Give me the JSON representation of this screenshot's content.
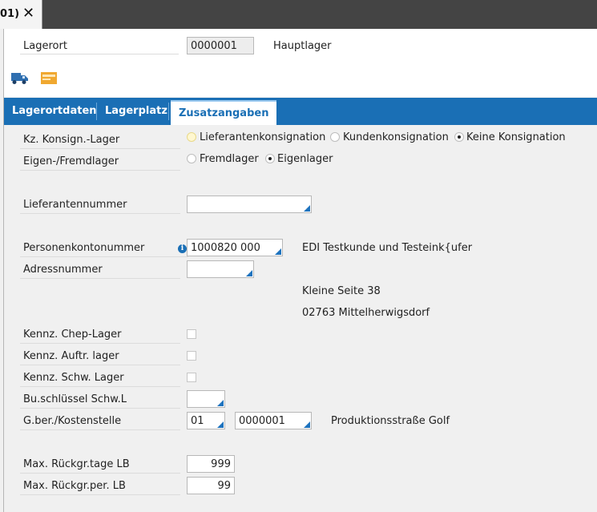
{
  "window": {
    "tab_label": "01)",
    "close_glyph": "✕"
  },
  "header": {
    "lagerort_label": "Lagerort",
    "lagerort_value": "0000001",
    "lagerort_name": "Hauptlager"
  },
  "toolbar": {
    "icons": [
      "truck-icon",
      "envelope-icon"
    ]
  },
  "tabs": [
    {
      "label": "Lagerortdaten",
      "active": false
    },
    {
      "label": "Lagerplatz",
      "active": false
    },
    {
      "label": "Zusatzangaben",
      "active": true
    }
  ],
  "form": {
    "konsign_label": "Kz. Konsign.-Lager",
    "konsign_options": [
      "Lieferantenkonsignation",
      "Kundenkonsignation",
      "Keine Konsignation"
    ],
    "konsign_selected": "Keine Konsignation",
    "eigen_label": "Eigen-/Fremdlager",
    "eigen_options": [
      "Fremdlager",
      "Eigenlager"
    ],
    "eigen_selected": "Eigenlager",
    "lieferant_label": "Lieferantennummer",
    "lieferant_value": "",
    "personenkonto_label": "Personenkontonummer",
    "personenkonto_value": "1000820 000",
    "personenkonto_name": "EDI Testkunde und Testeink{ufer",
    "adress_label": "Adressnummer",
    "adress_value": "",
    "address_line1": "Kleine Seite 38",
    "address_line2": "02763 Mittelherwigsdorf",
    "chep_label": "Kennz. Chep-Lager",
    "auftr_label": "Kennz. Auftr. lager",
    "schw_label": "Kennz. Schw. Lager",
    "buschl_label": "Bu.schlüssel Schw.L",
    "buschl_value": "",
    "gber_label": "G.ber./Kostenstelle",
    "gber_value": "01",
    "kostenstelle_value": "0000001",
    "kostenstelle_name": "Produktionsstraße Golf",
    "rueckgr_tage_label": "Max. Rückgr.tage LB",
    "rueckgr_tage_value": "999",
    "rueckgr_per_label": "Max. Rückgr.per. LB",
    "rueckgr_per_value": "99"
  },
  "colors": {
    "accent": "#1a6fb5",
    "titlebar": "#444444"
  }
}
